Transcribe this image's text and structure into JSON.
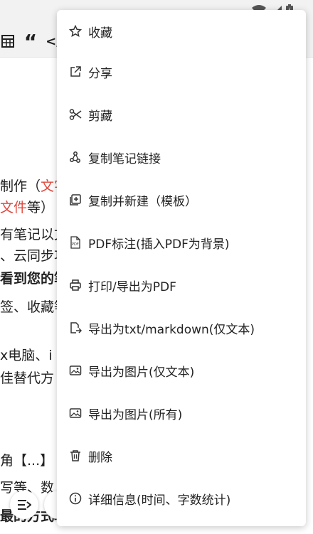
{
  "status_bar": {
    "wifi_icon": "wifi-icon",
    "signal_icon": "signal-icon",
    "battery_icon": "battery-icon"
  },
  "toolbar": {
    "quote_label": "“",
    "code_label": "</"
  },
  "editor": {
    "lines": [
      {
        "text_a": "制作（",
        "text_b": "文字"
      },
      {
        "text_a": "文件",
        "text_b": "等）"
      },
      {
        "text": "有笔记以文"
      },
      {
        "text": "、云同步功"
      },
      {
        "text": "看到您的笔"
      },
      {
        "text": "签、收藏等"
      },
      {
        "text": "x电脑、i"
      },
      {
        "text": "佳替代方"
      },
      {
        "text": "角【...】"
      },
      {
        "text": "写等、数"
      },
      {
        "text": "最的方式填"
      }
    ]
  },
  "menu": {
    "items": [
      {
        "label": "收藏",
        "icon": "star-icon"
      },
      {
        "label": "分享",
        "icon": "share-icon"
      },
      {
        "label": "剪藏",
        "icon": "scissors-icon"
      },
      {
        "label": "复制笔记链接",
        "icon": "link-icon"
      },
      {
        "label": "复制并新建（模板）",
        "icon": "copy-new-icon"
      },
      {
        "label": "PDF标注(插入PDF为背景)",
        "icon": "pdf-icon"
      },
      {
        "label": "打印/导出为PDF",
        "icon": "print-icon"
      },
      {
        "label": "导出为txt/markdown(仅文本)",
        "icon": "export-file-icon"
      },
      {
        "label": "导出为图片(仅文本)",
        "icon": "image-icon"
      },
      {
        "label": "导出为图片(所有)",
        "icon": "image-icon"
      },
      {
        "label": "删除",
        "icon": "trash-icon"
      },
      {
        "label": "详细信息(时间、字数统计)",
        "icon": "info-icon"
      }
    ]
  }
}
